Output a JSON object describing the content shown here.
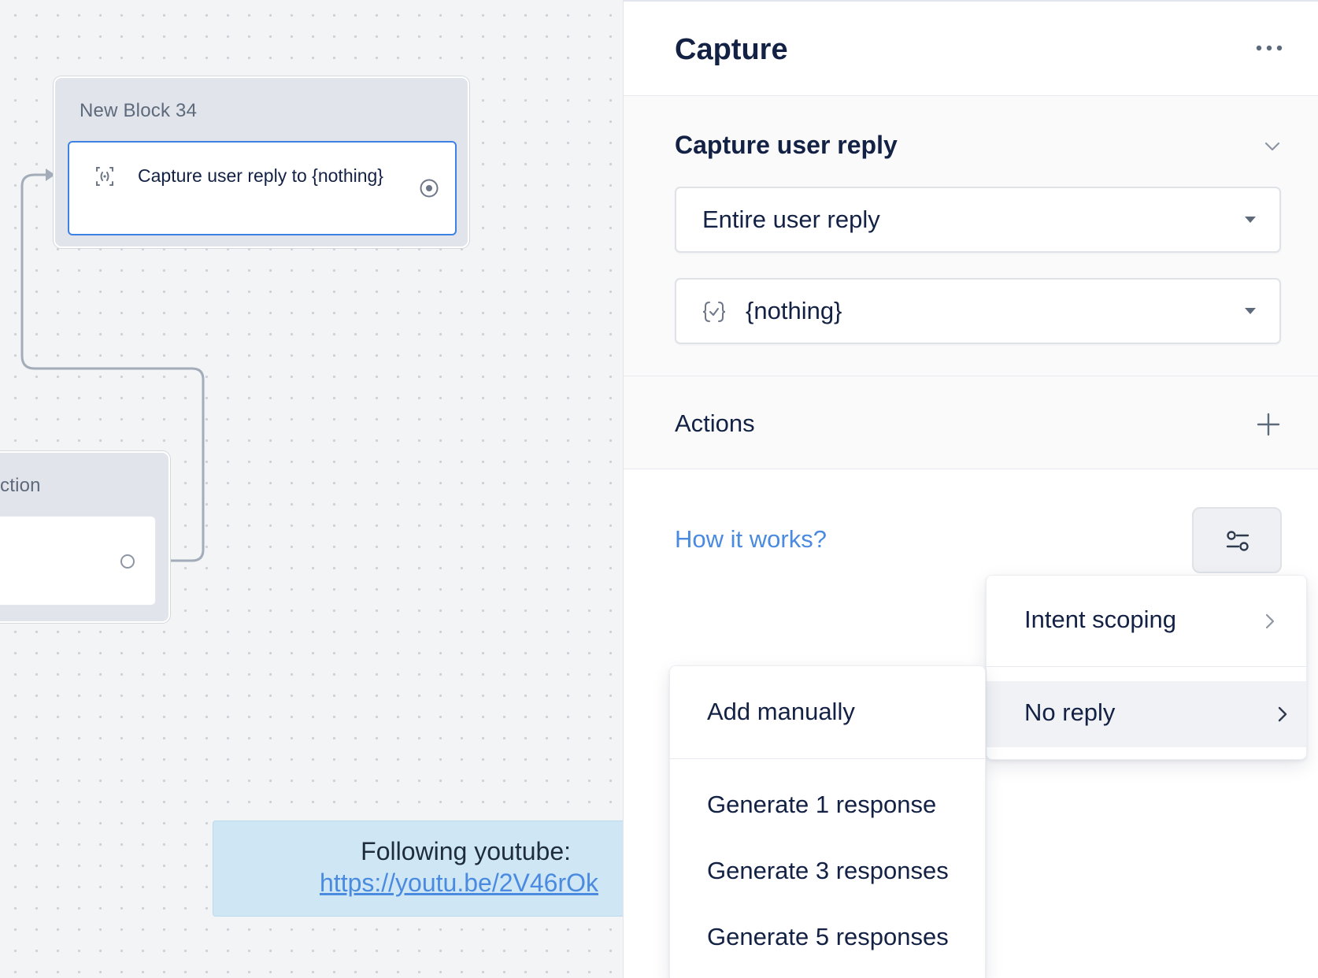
{
  "canvas": {
    "blocks": [
      {
        "title": "New Block 34",
        "step_text": "Capture user reply to {nothing}"
      },
      {
        "title": "ction"
      }
    ],
    "note": {
      "text": "Following youtube:",
      "link": "https://youtu.be/2V46rOk"
    }
  },
  "panel": {
    "title": "Capture",
    "capture_section": {
      "title": "Capture user reply",
      "reply_select": "Entire user reply",
      "variable_select": "{nothing}"
    },
    "actions_label": "Actions",
    "how_it_works": "How it works?"
  },
  "menus": {
    "settings_menu": [
      "Intent scoping",
      "No reply"
    ],
    "no_reply_submenu": [
      "Add manually",
      "Generate 1 response",
      "Generate 3 responses",
      "Generate 5 responses"
    ]
  },
  "icons": {
    "capture": "capture-icon",
    "port": "port-icon",
    "more": "more-icon",
    "chevron_down": "chevron-down-icon",
    "variable": "variable-icon",
    "plus": "plus-icon",
    "settings": "settings-icon",
    "chevron_right": "chevron-right-icon"
  },
  "colors": {
    "accent": "#3d82e2",
    "link": "#4a8be0",
    "text": "#132144",
    "note_bg": "#cfe6f5"
  }
}
